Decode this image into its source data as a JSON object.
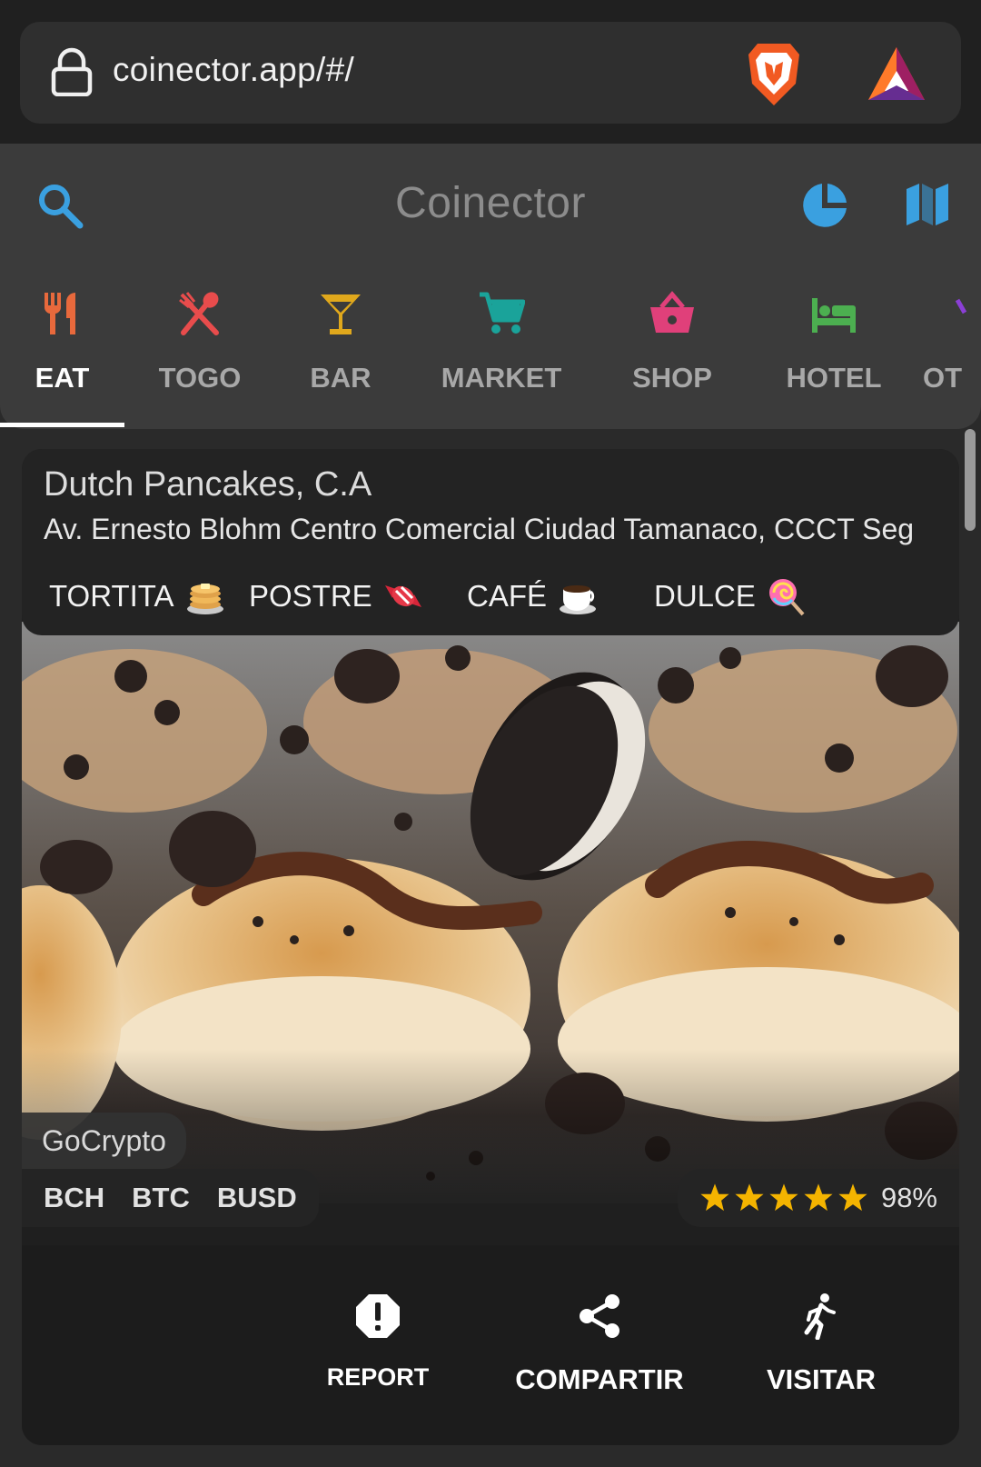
{
  "browser": {
    "url": "coinector.app/#/",
    "lock_icon": "lock-icon",
    "brave_icon": "brave-lion-icon",
    "rewards_icon": "bat-triangle-icon"
  },
  "header": {
    "title": "Coinector",
    "search_icon": "search-icon",
    "stats_icon": "pie-chart-icon",
    "map_icon": "map-icon"
  },
  "tabs": [
    {
      "label": "EAT",
      "icon": "fork-knife-icon",
      "color": "#e8693c",
      "active": true
    },
    {
      "label": "TOGO",
      "icon": "crossed-utensils-icon",
      "color": "#e84c4c"
    },
    {
      "label": "BAR",
      "icon": "cocktail-icon",
      "color": "#e0a81c"
    },
    {
      "label": "MARKET",
      "icon": "cart-icon",
      "color": "#1aa39a"
    },
    {
      "label": "SHOP",
      "icon": "basket-icon",
      "color": "#e0407a"
    },
    {
      "label": "HOTEL",
      "icon": "bed-icon",
      "color": "#4caf50"
    },
    {
      "label": "OT",
      "icon": "other-icon",
      "color": "#8b3fd6"
    }
  ],
  "place": {
    "name": "Dutch Pancakes, C.A",
    "address": "Av. Ernesto Blohm Centro Comercial Ciudad Tamanaco, CCCT Seg",
    "tags": [
      {
        "label": "TORTITA",
        "emoji": "pancakes-emoji"
      },
      {
        "label": "POSTRE",
        "emoji": "candy-emoji"
      },
      {
        "label": "CAFÉ",
        "emoji": "coffee-emoji"
      },
      {
        "label": "DULCE",
        "emoji": "lollipop-emoji"
      }
    ],
    "photo": "pancakes-photo",
    "payment_provider": "GoCrypto",
    "coins": [
      "BCH",
      "BTC",
      "BUSD"
    ],
    "rating": {
      "stars": 5,
      "percent": "98%",
      "star_color": "#f4b400"
    }
  },
  "actions": [
    {
      "label": "REPORT",
      "icon": "alert-octagon-icon"
    },
    {
      "label": "COMPARTIR",
      "icon": "share-icon"
    },
    {
      "label": "VISITAR",
      "icon": "walking-person-icon"
    }
  ],
  "colors": {
    "accent_blue": "#3aa0e0",
    "background": "#2a2a2a",
    "header": "#3b3b3b"
  }
}
